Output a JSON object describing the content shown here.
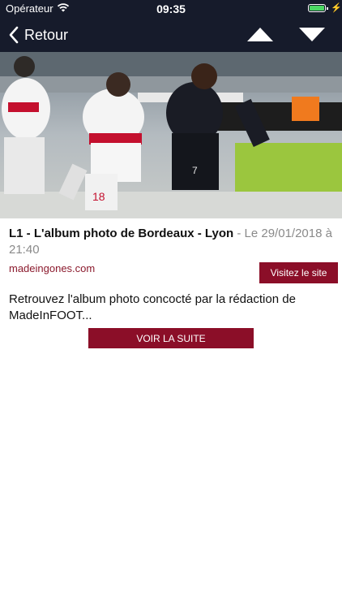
{
  "status_bar": {
    "carrier": "Opérateur",
    "time": "09:35"
  },
  "nav": {
    "back_label": "Retour"
  },
  "article": {
    "title": "L1 - L'album photo de Bordeaux - Lyon",
    "date": " - Le 29/01/2018 à 21:40",
    "source": "madeingones.com",
    "visit_label": "Visitez le site",
    "summary": "Retrouvez l'album photo concocté par la rédaction de MadeInFOOT...",
    "more_label": "VOIR LA SUITE"
  },
  "photo": {
    "kit_numbers": [
      "18",
      "7"
    ]
  },
  "colors": {
    "accent": "#8b0e28",
    "topbar": "#161b2b",
    "link": "#8b1a2d"
  }
}
